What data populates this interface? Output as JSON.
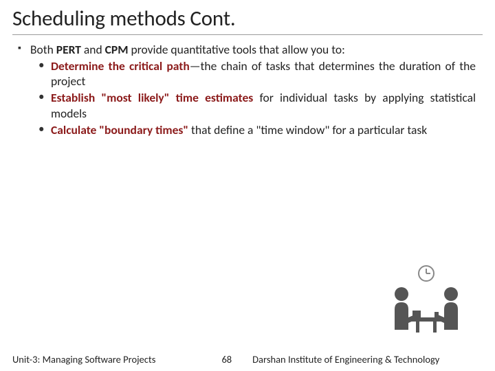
{
  "title": "Scheduling methods Cont.",
  "main": {
    "prefix": "Both ",
    "bold1": "PERT",
    "mid1": " and ",
    "bold2": "CPM",
    "suffix": " provide quantitative tools that allow you to:"
  },
  "subs": [
    {
      "bold": "Determine the critical path",
      "rest": "—the chain of tasks that determines the duration of the project"
    },
    {
      "bold": "Establish \"most likely\" time estimates",
      "rest": " for individual tasks by applying statistical models"
    },
    {
      "bold": "Calculate \"boundary times\"",
      "rest": " that define a \"time window\" for a particular task"
    }
  ],
  "footer": {
    "left": "Unit-3: Managing Software Projects",
    "center": "68",
    "right": "Darshan Institute of Engineering & Technology"
  }
}
